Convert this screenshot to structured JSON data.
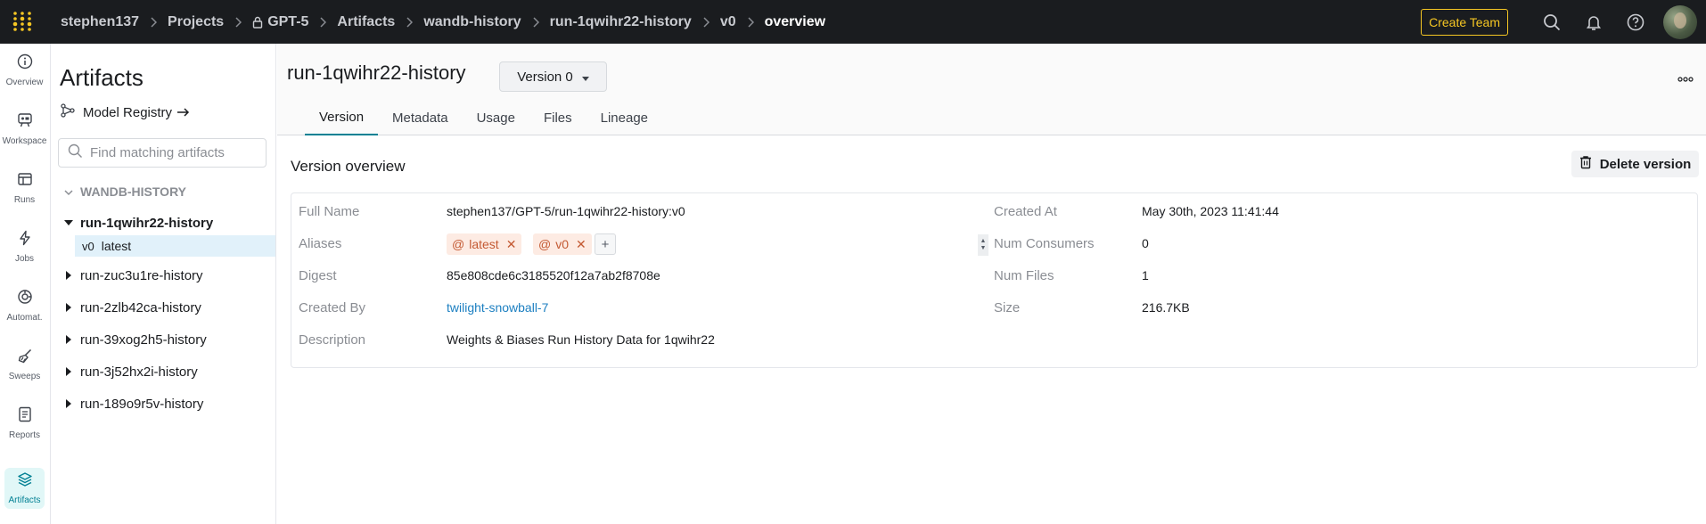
{
  "breadcrumbs": {
    "user": "stephen137",
    "projects": "Projects",
    "project": "GPT-5",
    "artifacts": "Artifacts",
    "type": "wandb-history",
    "artifact": "run-1qwihr22-history",
    "version": "v0",
    "page": "overview"
  },
  "topbar": {
    "create_team": "Create Team"
  },
  "rail": {
    "items": [
      {
        "label": "Overview",
        "icon": "info-icon"
      },
      {
        "label": "Workspace",
        "icon": "workspace-icon"
      },
      {
        "label": "Runs",
        "icon": "table-icon"
      },
      {
        "label": "Jobs",
        "icon": "lightning-icon"
      },
      {
        "label": "Automat.",
        "icon": "automation-icon"
      },
      {
        "label": "Sweeps",
        "icon": "broom-icon"
      },
      {
        "label": "Reports",
        "icon": "report-icon"
      },
      {
        "label": "Artifacts",
        "icon": "layers-icon",
        "active": true
      }
    ]
  },
  "sidebar": {
    "title": "Artifacts",
    "model_registry": "Model Registry",
    "search_placeholder": "Find matching artifacts",
    "group": "WANDB-HISTORY",
    "open_item": "run-1qwihr22-history",
    "open_version": {
      "version": "v0",
      "alias": "latest"
    },
    "items": [
      "run-zuc3u1re-history",
      "run-2zlb42ca-history",
      "run-39xog2h5-history",
      "run-3j52hx2i-history",
      "run-189o9r5v-history"
    ]
  },
  "main": {
    "title": "run-1qwihr22-history",
    "version_select": "Version 0",
    "tabs": [
      "Version",
      "Metadata",
      "Usage",
      "Files",
      "Lineage"
    ],
    "active_tab": "Version",
    "section_title": "Version overview",
    "delete_button": "Delete version",
    "fields": {
      "full_name_label": "Full Name",
      "full_name": "stephen137/GPT-5/run-1qwihr22-history:v0",
      "aliases_label": "Aliases",
      "aliases": [
        "latest",
        "v0"
      ],
      "add_alias": "+",
      "digest_label": "Digest",
      "digest": "85e808cde6c3185520f12a7ab2f8708e",
      "created_by_label": "Created By",
      "created_by": "twilight-snowball-7",
      "description_label": "Description",
      "description": "Weights & Biases Run History Data for 1qwihr22",
      "created_at_label": "Created At",
      "created_at": "May 30th, 2023 11:41:44",
      "num_consumers_label": "Num Consumers",
      "num_consumers": "0",
      "num_files_label": "Num Files",
      "num_files": "1",
      "size_label": "Size",
      "size": "216.7KB"
    }
  },
  "colors": {
    "topbar_bg": "#1a1c1f",
    "accent_teal": "#038194",
    "create_team": "#f5c623",
    "link": "#1c7fc1",
    "alias_bg": "#fdebe3",
    "alias_text": "#c45a33"
  }
}
